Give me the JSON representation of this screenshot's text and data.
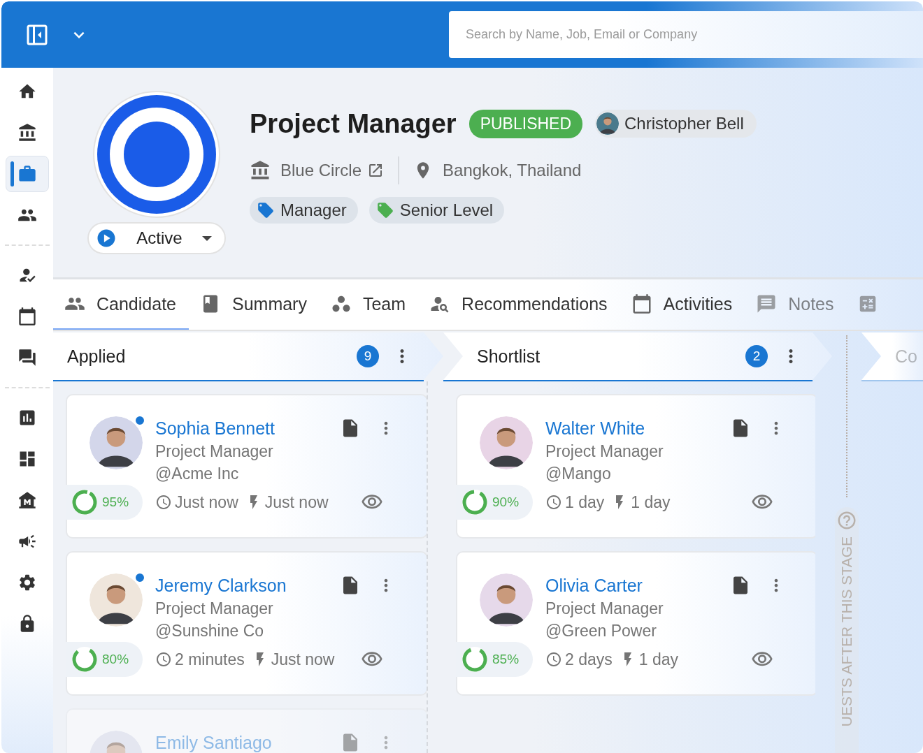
{
  "header": {
    "search": {
      "placeholder": "Search by Name, Job, Email or Company"
    }
  },
  "sidebar": {
    "groups": [
      {
        "items": [
          {
            "selected": false
          },
          {
            "selected": false
          },
          {
            "selected": true
          },
          {
            "selected": false
          }
        ]
      },
      {
        "items": [
          {
            "selected": false
          },
          {
            "selected": false
          },
          {
            "selected": false
          }
        ]
      },
      {
        "items": [
          {
            "selected": false
          },
          {
            "selected": false
          },
          {
            "selected": false
          },
          {
            "selected": false
          },
          {
            "selected": false
          },
          {
            "selected": false
          }
        ]
      }
    ]
  },
  "job": {
    "title": "Project Manager",
    "status_badge": "PUBLISHED",
    "owner": "Christopher Bell",
    "company": "Blue Circle",
    "location": "Bangkok, Thailand",
    "state": "Active",
    "tags": [
      {
        "label": "Manager",
        "color": "#1976d2"
      },
      {
        "label": "Senior Level",
        "color": "#4caf50"
      }
    ]
  },
  "tabs": [
    {
      "label": "Candidate",
      "selected": true
    },
    {
      "label": "Summary",
      "selected": false
    },
    {
      "label": "Team",
      "selected": false
    },
    {
      "label": "Recommendations",
      "selected": false
    },
    {
      "label": "Activities",
      "selected": false
    },
    {
      "label": "Notes",
      "selected": false
    },
    {
      "selected": false
    }
  ],
  "stages": [
    {
      "title": "Applied",
      "count": "9",
      "cards": [
        {
          "name": "Sophia Bennett",
          "title": "Project Manager",
          "company": "@Acme Inc",
          "score": "95%",
          "level": 0.95,
          "time_created": "Just now",
          "time_activity": "Just now",
          "online": true
        },
        {
          "name": "Jeremy Clarkson",
          "title": "Project Manager",
          "company": "@Sunshine Co",
          "score": "80%",
          "level": 0.8,
          "time_created": "2 minutes",
          "time_activity": "Just now",
          "online": true
        },
        {
          "name": "Emily Santiago"
        }
      ]
    },
    {
      "title": "Shortlist",
      "count": "2",
      "cards": [
        {
          "name": "Walter White",
          "title": "Project Manager",
          "company": "@Mango",
          "score": "90%",
          "level": 0.9,
          "time_created": "1 day",
          "time_activity": "1 day",
          "online": false
        },
        {
          "name": "Olivia Carter",
          "title": "Project Manager",
          "company": "@Green Power",
          "score": "85%",
          "level": 0.85,
          "time_created": "2 days",
          "time_activity": "1 day",
          "online": false
        }
      ]
    },
    {
      "title": "Co"
    }
  ],
  "stage_note": "UESTS AFTER THIS STAGE"
}
